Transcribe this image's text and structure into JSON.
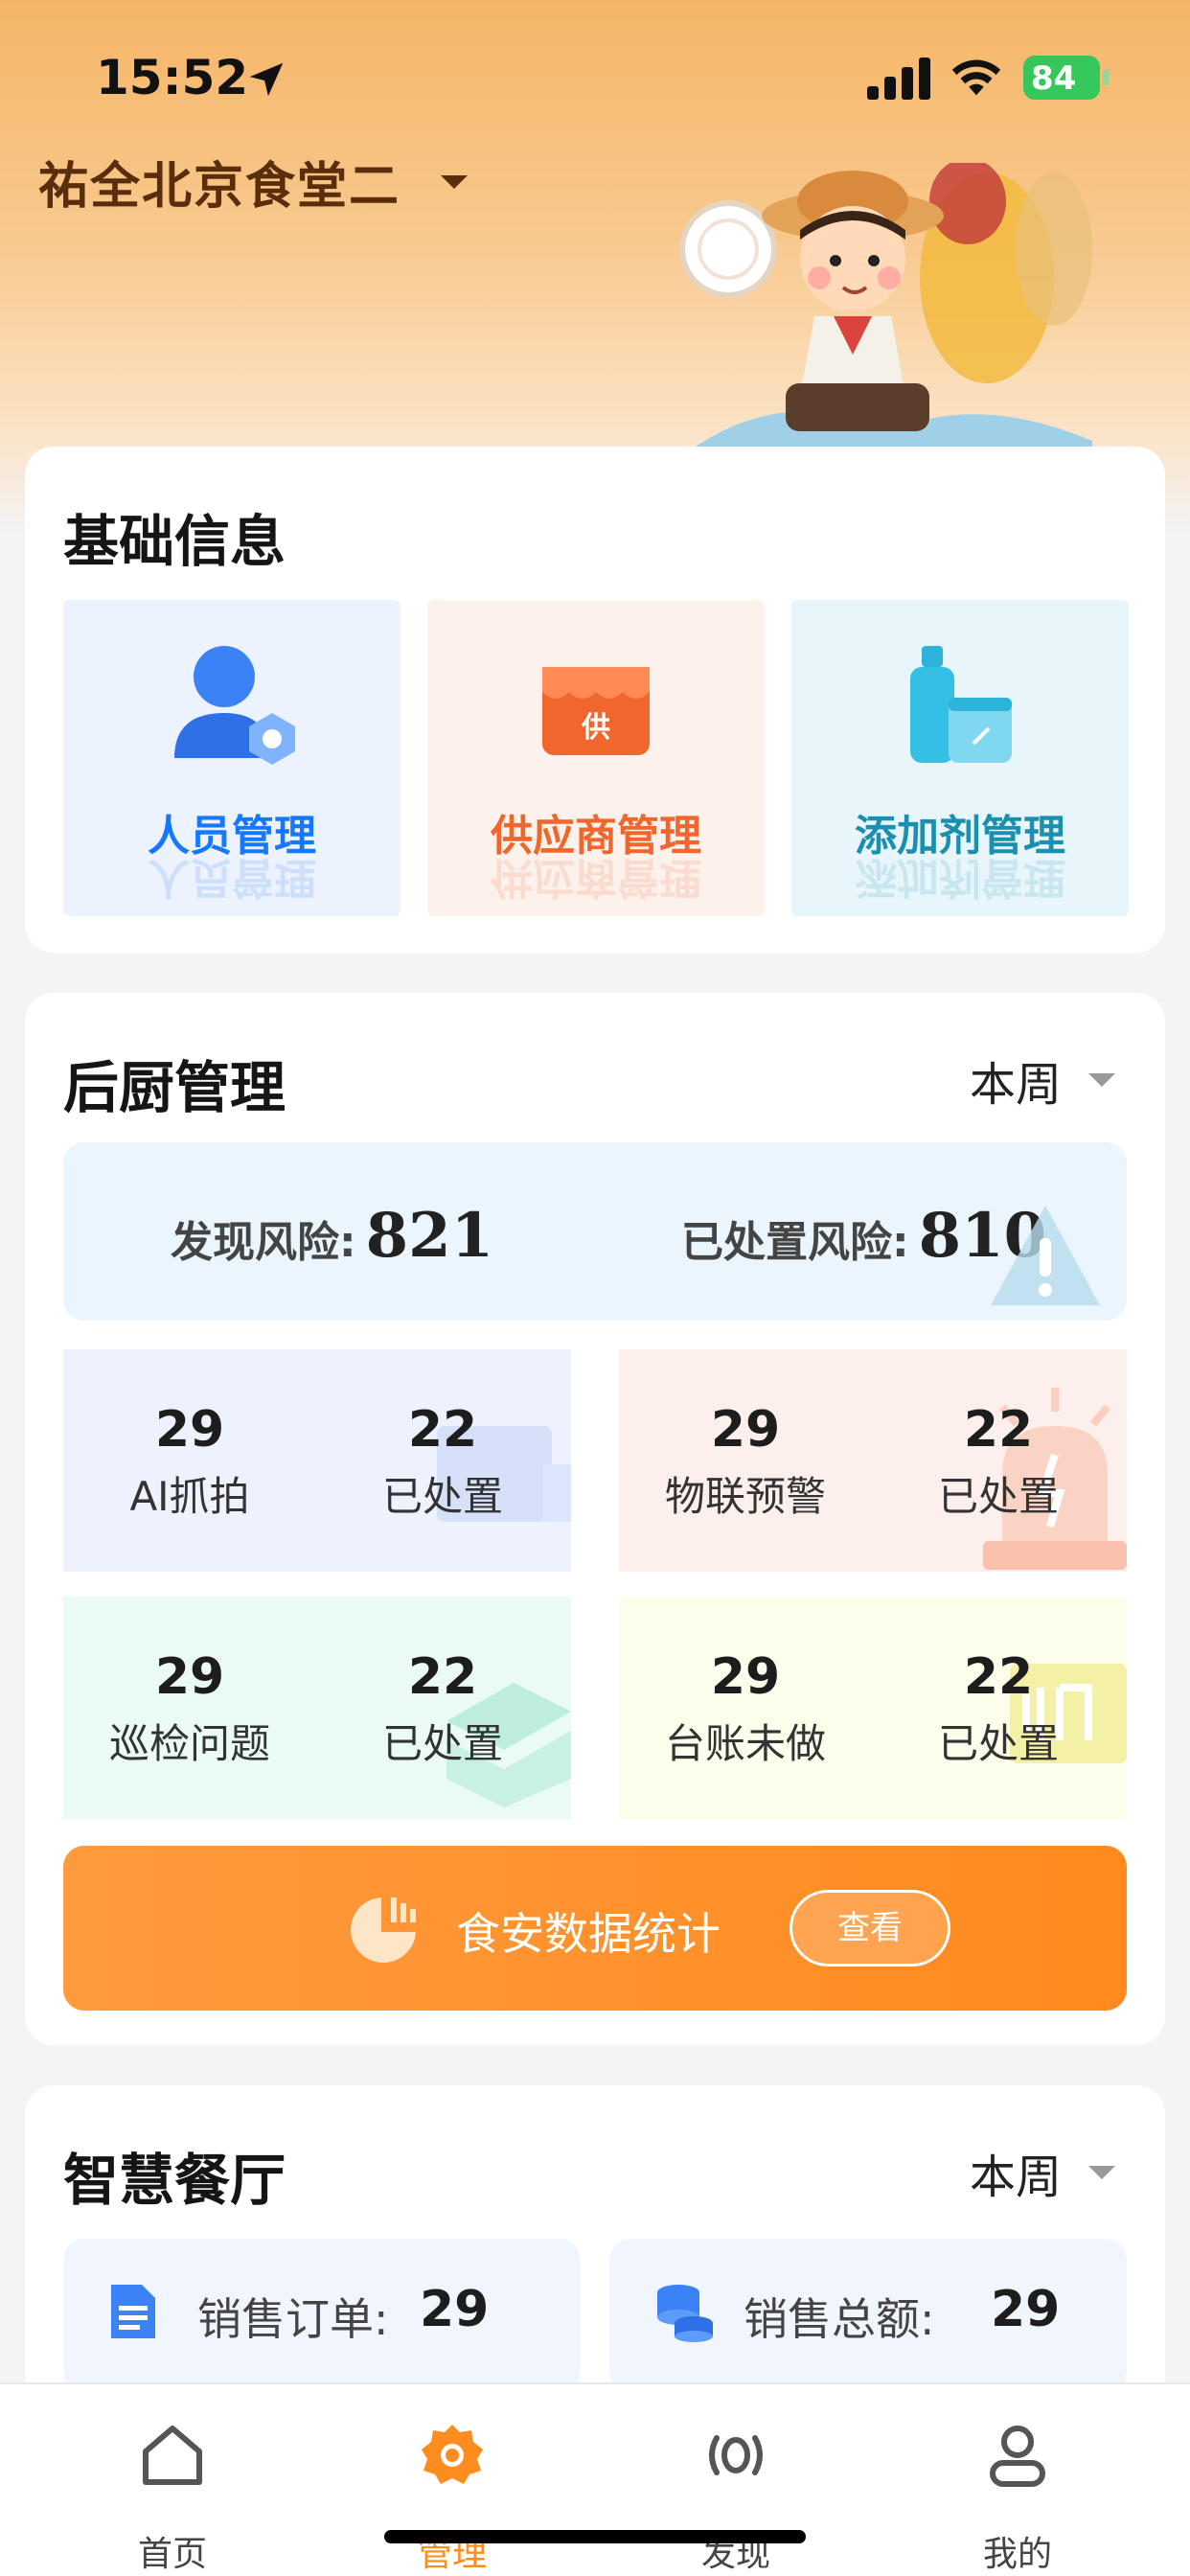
{
  "status_bar": {
    "time": "15:52",
    "battery": "84"
  },
  "header": {
    "canteen_name": "祐全北京食堂二"
  },
  "basic_info": {
    "title": "基础信息",
    "tiles": [
      {
        "label": "人员管理",
        "icon": "person-gear-icon",
        "color": "#1677ff"
      },
      {
        "label": "供应商管理",
        "icon": "supplier-shop-icon",
        "icon_text": "供",
        "color": "#f0662c"
      },
      {
        "label": "添加剂管理",
        "icon": "bottle-jar-icon",
        "color": "#1a8fb0"
      }
    ]
  },
  "kitchen": {
    "title": "后厨管理",
    "period": "本周",
    "risk_found_label": "发现风险:",
    "risk_found_value": "821",
    "risk_handled_label": "已处置风险:",
    "risk_handled_value": "810",
    "stats": [
      {
        "count": "29",
        "label": "AI抓拍",
        "handled_count": "22",
        "handled_label": "已处置"
      },
      {
        "count": "29",
        "label": "物联预警",
        "handled_count": "22",
        "handled_label": "已处置"
      },
      {
        "count": "29",
        "label": "巡检问题",
        "handled_count": "22",
        "handled_label": "已处置"
      },
      {
        "count": "29",
        "label": "台账未做",
        "handled_count": "22",
        "handled_label": "已处置"
      }
    ],
    "food_stats_label": "食安数据统计",
    "view_label": "查看"
  },
  "smart": {
    "title": "智慧餐厅",
    "period": "本周",
    "sales_orders_label": "销售订单:",
    "sales_orders_value": "29",
    "sales_total_label": "销售总额:",
    "sales_total_value": "29"
  },
  "tabs": [
    {
      "label": "首页",
      "icon": "home-icon"
    },
    {
      "label": "管理",
      "icon": "gear-icon",
      "active": true
    },
    {
      "label": "发现",
      "icon": "broadcast-icon"
    },
    {
      "label": "我的",
      "icon": "user-icon"
    }
  ],
  "colors": {
    "accent": "#ff8c1f",
    "header": "#f5b567"
  }
}
